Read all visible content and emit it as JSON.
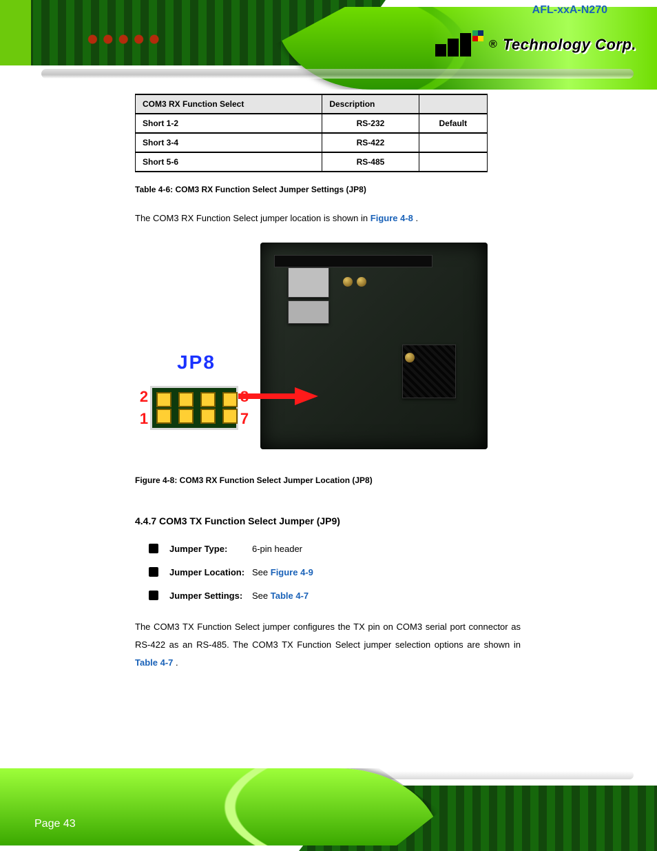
{
  "brand": {
    "registered": "®",
    "name": "Technology Corp."
  },
  "product_name": "AFL-xxA-N270",
  "rx": {
    "table": {
      "headers": [
        "COM3 RX Function Select",
        "Description",
        ""
      ],
      "rows": [
        [
          "Short 1-2",
          "RS-232",
          "Default"
        ],
        [
          "Short 3-4",
          "RS-422",
          ""
        ],
        [
          "Short 5-6",
          "RS-485",
          ""
        ]
      ]
    },
    "table_caption": "Table 4-6: COM3 RX Function Select Jumper Settings (JP8)",
    "location_sentence_pre": "The COM3 RX Function Select jumper location is shown in ",
    "location_ref": "Figure 4-8",
    "location_sentence_post": ".",
    "jumper_label": "JP8",
    "pins": {
      "tl": "2",
      "tr": "8",
      "bl": "1",
      "br": "7"
    },
    "figure_caption": "Figure 4-8: COM3 RX Function Select Jumper Location (JP8)"
  },
  "tx": {
    "section_title": "4.4.7 COM3 TX Function Select Jumper (JP9)",
    "spec": {
      "type_label": "Jumper Type:",
      "type_value": "6-pin header",
      "loc_label": "Jumper Location:",
      "loc_value_pre": "See ",
      "loc_ref": "Figure 4-9",
      "set_label": "Jumper Settings:",
      "set_value_pre": "See ",
      "set_ref": "Table 4-7"
    },
    "paragraph_pre": "The COM3 TX Function Select jumper configures the TX pin on COM3 serial port connector as RS-422 as an RS-485. The COM3 TX Function Select jumper selection options are shown in ",
    "paragraph_ref": "Table 4-7",
    "paragraph_post": "."
  },
  "footer": {
    "page_label": "Page 43"
  }
}
